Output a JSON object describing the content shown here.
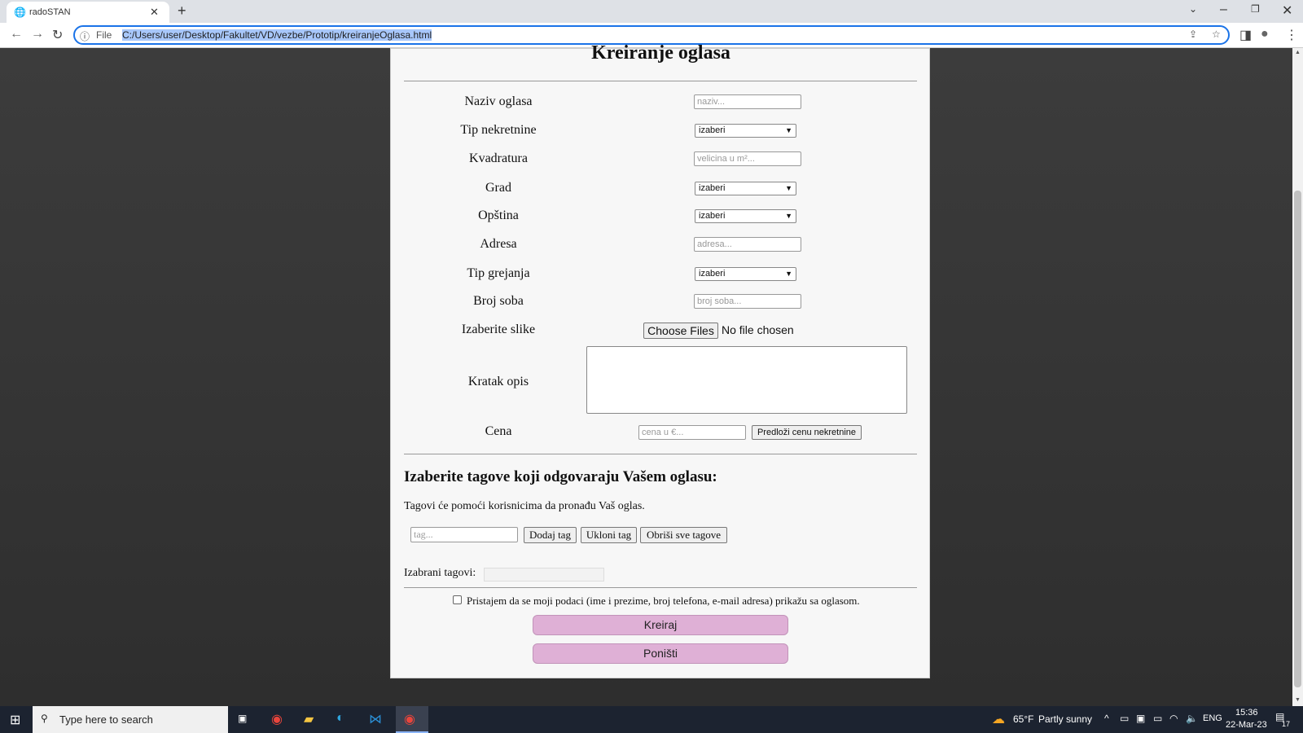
{
  "browser": {
    "tab_title": "radoSTAN",
    "url_scheme": "File",
    "url": "C:/Users/user/Desktop/Fakultet/VD/vezbe/Prototip/kreiranjeOglasa.html"
  },
  "form": {
    "title": "Kreiranje oglasa",
    "fields": [
      {
        "label": "Naziv oglasa",
        "type": "input",
        "placeholder": "naziv..."
      },
      {
        "label": "Tip nekretnine",
        "type": "select",
        "value": "izaberi"
      },
      {
        "label": "Kvadratura",
        "type": "input",
        "placeholder": "velicina u m²..."
      },
      {
        "label": "Grad",
        "type": "select",
        "value": "izaberi"
      },
      {
        "label": "Opština",
        "type": "select",
        "value": "izaberi"
      },
      {
        "label": "Adresa",
        "type": "input",
        "placeholder": "adresa..."
      },
      {
        "label": "Tip grejanja",
        "type": "select",
        "value": "izaberi"
      },
      {
        "label": "Broj soba",
        "type": "input",
        "placeholder": "broj soba..."
      }
    ],
    "images": {
      "label": "Izaberite slike",
      "button": "Choose Files",
      "status": "No file chosen"
    },
    "description": {
      "label": "Kratak opis"
    },
    "price": {
      "label": "Cena",
      "placeholder": "cena u €...",
      "suggest_button": "Predloži cenu nekretnine"
    },
    "tags": {
      "heading": "Izaberite tagove koji odgovaraju Vašem oglasu:",
      "hint": "Tagovi će pomoći korisnicima da pronađu Vaš oglas.",
      "placeholder": "tag...",
      "add": "Dodaj tag",
      "remove": "Ukloni tag",
      "clear": "Obriši sve tagove",
      "selected_label": "Izabrani tagovi:"
    },
    "consent": "Pristajem da se moji podaci (ime i prezime, broj telefona, e-mail adresa) prikažu sa oglasom.",
    "consent_checked": false,
    "create_button": "Kreiraj",
    "cancel_button": "Poništi",
    "button_color": "#dfb0d6"
  },
  "taskbar": {
    "search_placeholder": "Type here to search",
    "weather_temp": "65°F",
    "weather_text": "Partly sunny",
    "lang": "ENG",
    "time": "15:36",
    "date": "22-Mar-23",
    "notifications": "17"
  }
}
